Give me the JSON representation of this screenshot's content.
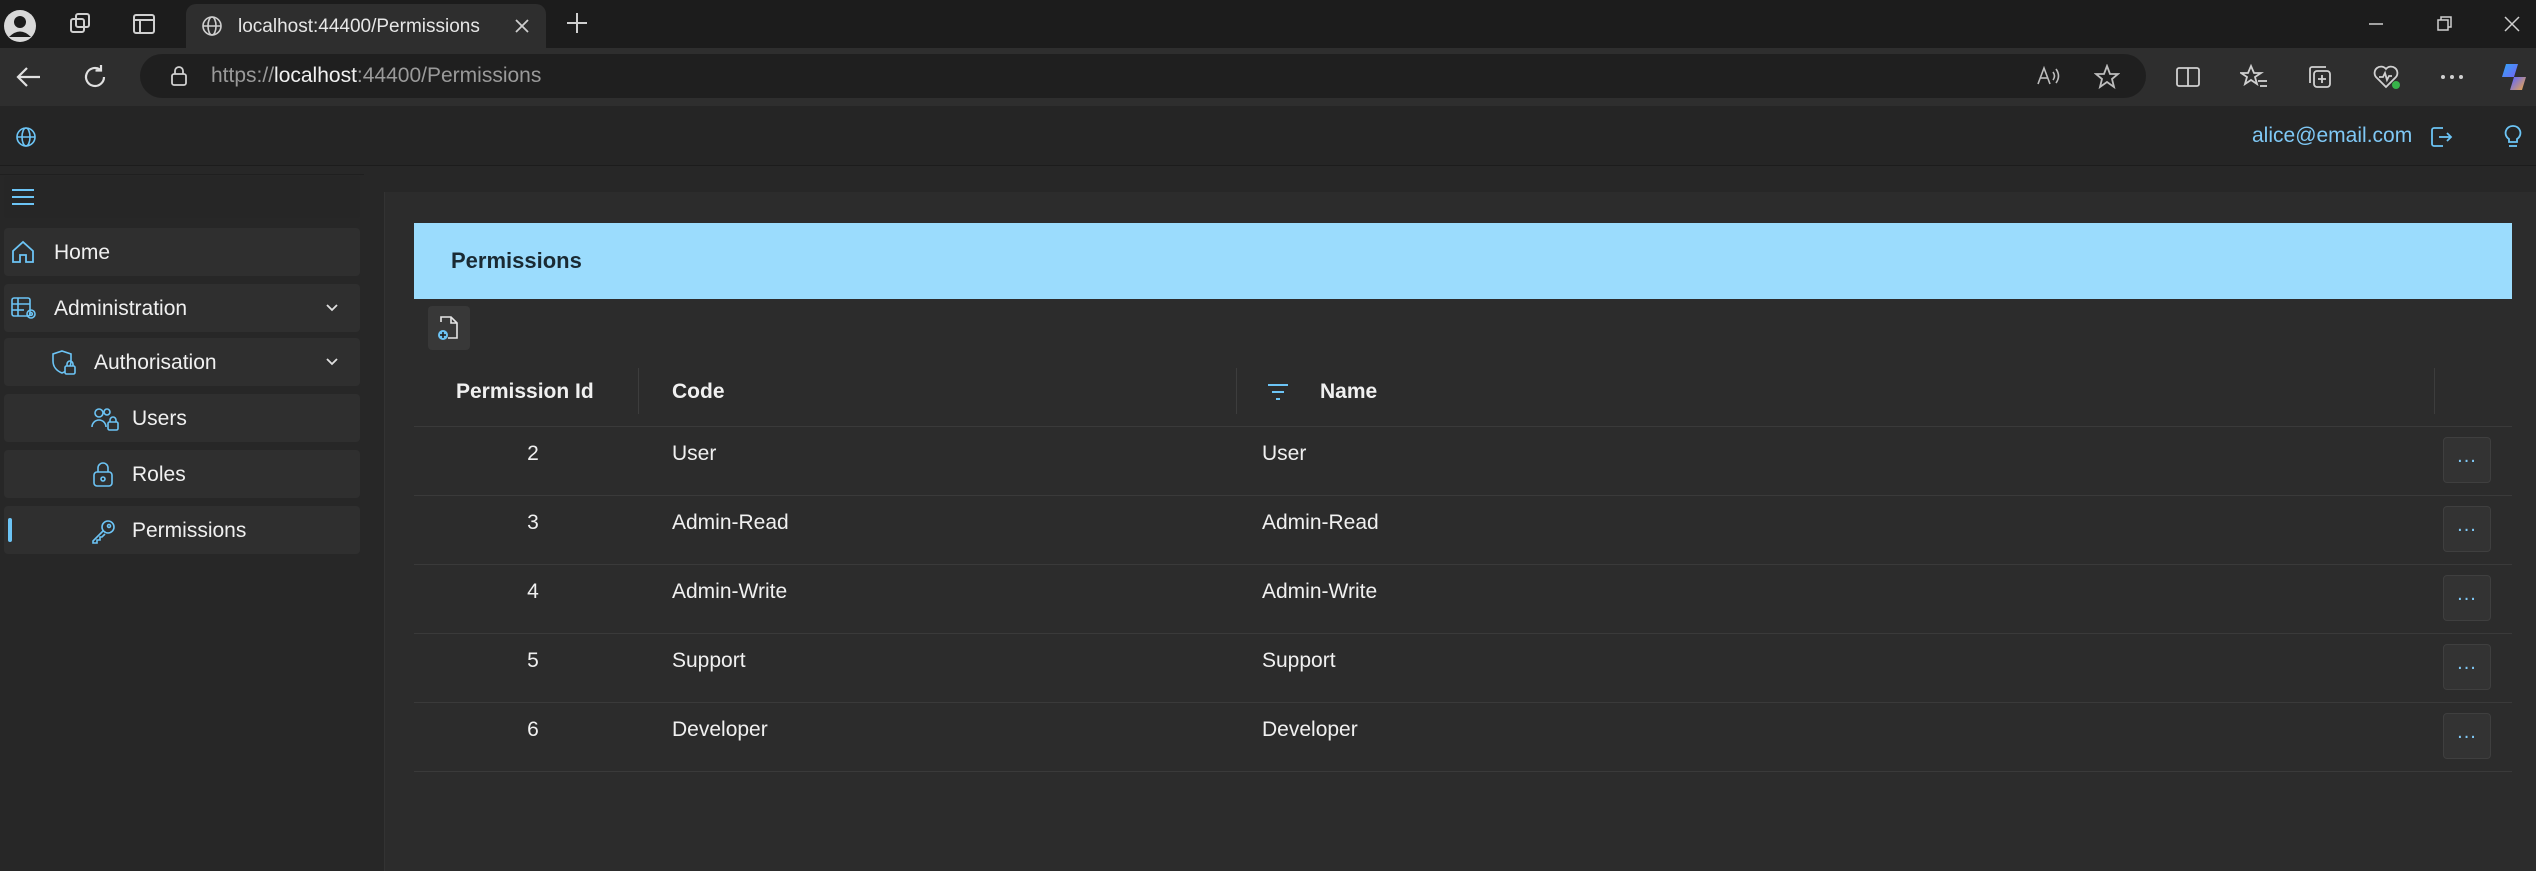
{
  "browser": {
    "tab_title": "localhost:44400/Permissions",
    "url_prefix": "https://",
    "url_host": "localhost",
    "url_rest": ":44400/Permissions"
  },
  "header": {
    "user_email": "alice@email.com"
  },
  "sidebar": {
    "items": [
      {
        "label": "Home",
        "icon": "home-icon"
      },
      {
        "label": "Administration",
        "icon": "admin-icon"
      },
      {
        "label": "Authorisation",
        "icon": "shield-lock-icon"
      },
      {
        "label": "Users",
        "icon": "users-lock-icon"
      },
      {
        "label": "Roles",
        "icon": "lock-icon"
      },
      {
        "label": "Permissions",
        "icon": "key-icon",
        "active": true
      }
    ]
  },
  "main": {
    "title": "Permissions",
    "columns": [
      "Permission Id",
      "Code",
      "Name"
    ],
    "rows": [
      {
        "id": "2",
        "code": "User",
        "name": "User"
      },
      {
        "id": "3",
        "code": "Admin-Read",
        "name": "Admin-Read"
      },
      {
        "id": "4",
        "code": "Admin-Write",
        "name": "Admin-Write"
      },
      {
        "id": "5",
        "code": "Support",
        "name": "Support"
      },
      {
        "id": "6",
        "code": "Developer",
        "name": "Developer"
      }
    ],
    "row_action_label": "..."
  },
  "colors": {
    "accent": "#6cc4f5",
    "banner": "#9bdcfd",
    "background": "#272727"
  }
}
